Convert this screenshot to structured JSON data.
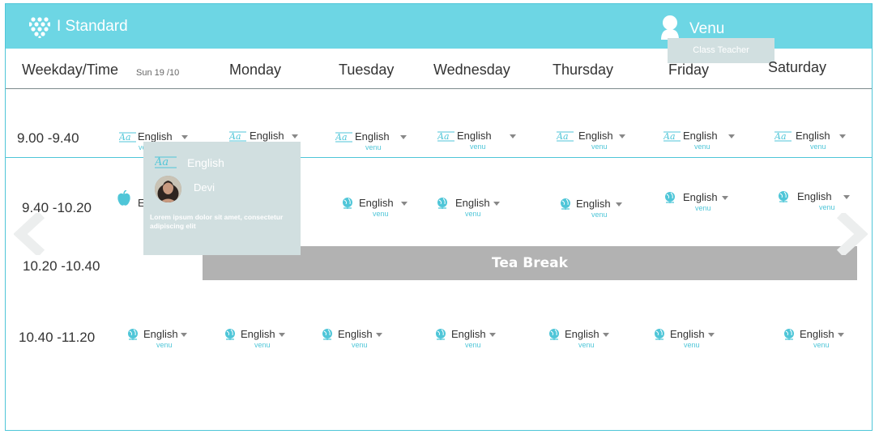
{
  "header": {
    "title": "I Standard",
    "user_name": "Venu",
    "user_role": "Class Teacher"
  },
  "colors": {
    "topbar": "#6dd6e4",
    "accent": "#4fc6d8",
    "tea_break": "#b2b2b2",
    "popup": "#d1dfe0"
  },
  "table": {
    "first_header": "Weekday/Time",
    "date": "Sun 19 /10",
    "days": [
      "Monday",
      "Tuesday",
      "Wednesday",
      "Thursday",
      "Friday",
      "Saturday"
    ],
    "times": [
      "9.00 -9.40",
      "9.40 -10.20",
      "10.20 -10.40",
      "10.40 -11.20"
    ],
    "break_label": "Tea Break"
  },
  "slots": {
    "row1": [
      {
        "subject": "English",
        "teacher": "venu",
        "icon": "language-icon"
      },
      {
        "subject": "English",
        "teacher": "venu",
        "icon": "language-icon"
      },
      {
        "subject": "English",
        "teacher": "venu",
        "icon": "language-icon"
      },
      {
        "subject": "English",
        "teacher": "venu",
        "icon": "language-icon"
      },
      {
        "subject": "English",
        "teacher": "venu",
        "icon": "language-icon"
      },
      {
        "subject": "English",
        "teacher": "venu",
        "icon": "language-icon"
      },
      {
        "subject": "English",
        "teacher": "venu",
        "icon": "language-icon"
      }
    ],
    "row2": [
      {
        "subject": "English",
        "teacher": "venu",
        "icon": "globe-icon"
      },
      {
        "subject": "English",
        "teacher": "venu",
        "icon": "globe-icon"
      },
      {
        "subject": "English",
        "teacher": "venu",
        "icon": "globe-icon"
      },
      {
        "subject": "English",
        "teacher": "venu",
        "icon": "globe-icon"
      },
      {
        "subject": "English",
        "teacher": "venu",
        "icon": "globe-icon"
      }
    ],
    "row4": [
      {
        "subject": "English",
        "teacher": "venu",
        "icon": "globe-icon"
      },
      {
        "subject": "English",
        "teacher": "venu",
        "icon": "globe-icon"
      },
      {
        "subject": "English",
        "teacher": "venu",
        "icon": "globe-icon"
      },
      {
        "subject": "English",
        "teacher": "venu",
        "icon": "globe-icon"
      },
      {
        "subject": "English",
        "teacher": "venu",
        "icon": "globe-icon"
      },
      {
        "subject": "English",
        "teacher": "venu",
        "icon": "globe-icon"
      },
      {
        "subject": "English",
        "teacher": "venu",
        "icon": "globe-icon"
      }
    ]
  },
  "popup": {
    "subject": "English",
    "teacher": "Devi",
    "description": "Lorem ipsum dolor sit amet, consectetur adipiscing elit"
  },
  "row2_partial_subject": "E"
}
